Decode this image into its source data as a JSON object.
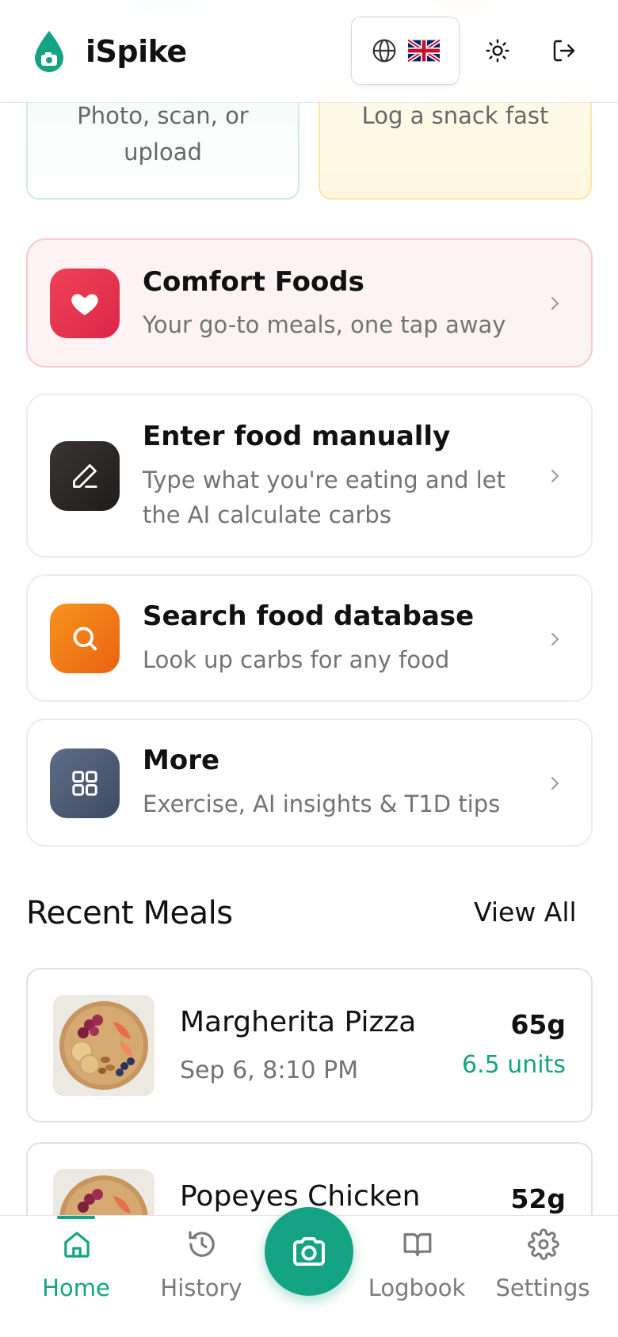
{
  "header": {
    "title": "iSpike",
    "language_flag": "🇬🇧",
    "language_icon": "globe-icon",
    "theme_icon": "sun-icon",
    "logout_icon": "logout-icon"
  },
  "top_cards": [
    {
      "subtitle": "Photo, scan, or upload",
      "color": "#cdeee3"
    },
    {
      "subtitle": "Log a snack fast",
      "color": "#fbe5a8"
    }
  ],
  "actions": [
    {
      "title": "Comfort Foods",
      "subtitle": "Your go-to meals, one tap away",
      "icon": "heart-icon",
      "color": "#e5304f"
    },
    {
      "title": "Enter food manually",
      "subtitle": "Type what you're eating and let the AI calculate carbs",
      "icon": "pencil-icon",
      "color": "#2b2724"
    },
    {
      "title": "Search food database",
      "subtitle": "Look up carbs for any food",
      "icon": "search-icon",
      "color": "#f07314"
    },
    {
      "title": "More",
      "subtitle": "Exercise, AI insights & T1D tips",
      "icon": "grid-icon",
      "color": "#4f5e78"
    }
  ],
  "recent": {
    "title": "Recent Meals",
    "view_all": "View All",
    "meals": [
      {
        "name": "Margherita Pizza",
        "date": "Sep 6, 8:10 PM",
        "carbs": "65g",
        "units": "6.5 units"
      },
      {
        "name": "Popeyes Chicken",
        "date": "",
        "carbs": "52g",
        "units": ""
      }
    ]
  },
  "nav": {
    "items": [
      {
        "label": "Home",
        "icon": "home-icon",
        "active": true
      },
      {
        "label": "History",
        "icon": "history-icon",
        "active": false
      },
      {
        "label": "Logbook",
        "icon": "book-icon",
        "active": false
      },
      {
        "label": "Settings",
        "icon": "gear-icon",
        "active": false
      }
    ],
    "camera_icon": "camera-icon"
  },
  "colors": {
    "accent": "#14a483",
    "pink_card": "#fdf3f4"
  }
}
